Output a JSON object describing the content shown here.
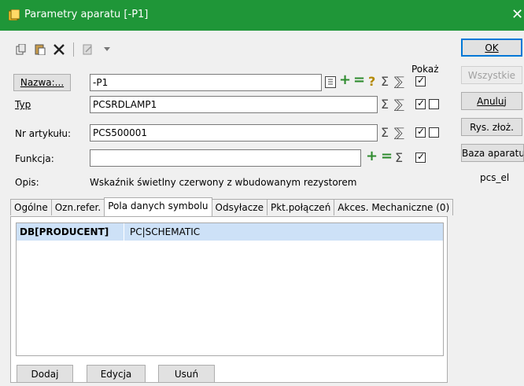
{
  "window": {
    "title": "Parametry aparatu [-P1]",
    "close_glyph": "✕",
    "accent_color": "#1f9638",
    "app_icon": "app-icon"
  },
  "toolbar": {
    "icons": [
      "copy-icon",
      "paste-icon",
      "delete-icon",
      "edit-icon",
      "dropdown-icon"
    ]
  },
  "fields": {
    "pokaz_label": "Pokaż",
    "nazwa": {
      "label": "Nazwa:...",
      "value": "-P1",
      "show": true
    },
    "typ": {
      "label": "Typ",
      "value": "PCSRDLAMP1",
      "show": true,
      "show2": false
    },
    "nr_artykulu": {
      "label": "Nr artykułu:",
      "value": "PCS500001",
      "show": true,
      "show2": false
    },
    "funkcja": {
      "label": "Funkcja:",
      "value": "",
      "show": true
    },
    "opis": {
      "label": "Opis:",
      "value": "Wskaźnik świetlny czerwony z wbudowanym rezystorem"
    }
  },
  "side_buttons": {
    "ok": "OK",
    "wszystkie": "Wszystkie",
    "anuluj": "Anuluj",
    "rys_zloz": "Rys. złoż.",
    "baza": "Baza aparatury",
    "db_name": "pcs_el"
  },
  "tabs": [
    {
      "label": "Ogólne",
      "active": false
    },
    {
      "label": "Ozn.refer.",
      "active": false
    },
    {
      "label": "Pola danych symbolu",
      "active": true
    },
    {
      "label": "Odsyłacze",
      "active": false
    },
    {
      "label": "Pkt.połączeń",
      "active": false
    },
    {
      "label": "Akces. Mechaniczne (0)",
      "active": false
    }
  ],
  "grid": {
    "rows": [
      {
        "key": "DB[PRODUCENT]",
        "value": "PC|SCHEMATIC"
      }
    ]
  },
  "bottom_buttons": {
    "dodaj": "Dodaj",
    "edycja": "Edycja",
    "usun": "Usuń"
  },
  "symbols": {
    "sigma": "Σ",
    "sigma_arrow": "⅀",
    "plus": "+",
    "minus": "=",
    "question": "?"
  }
}
